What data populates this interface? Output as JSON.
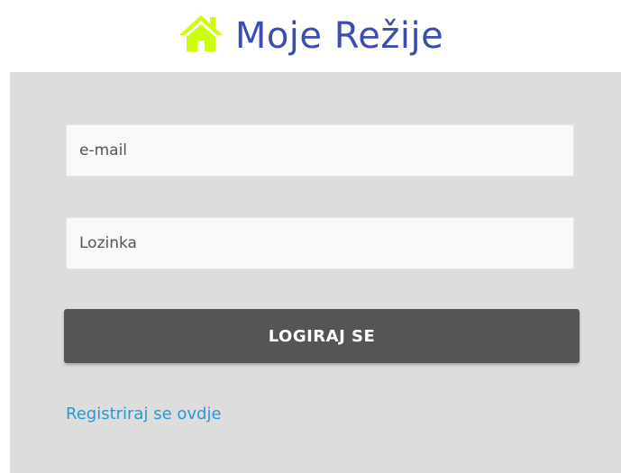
{
  "header": {
    "title": "Moje Režije",
    "logo_icon": "house-icon",
    "logo_color": "#ccff00",
    "title_color": "#3b4db0"
  },
  "login_form": {
    "email_placeholder": "e-mail",
    "password_placeholder": "Lozinka",
    "submit_label": "LOGIRAJ SE",
    "register_link": "Registriraj se ovdje",
    "panel_color": "#dddddd",
    "button_color": "#555555",
    "link_color": "#2699d4"
  }
}
